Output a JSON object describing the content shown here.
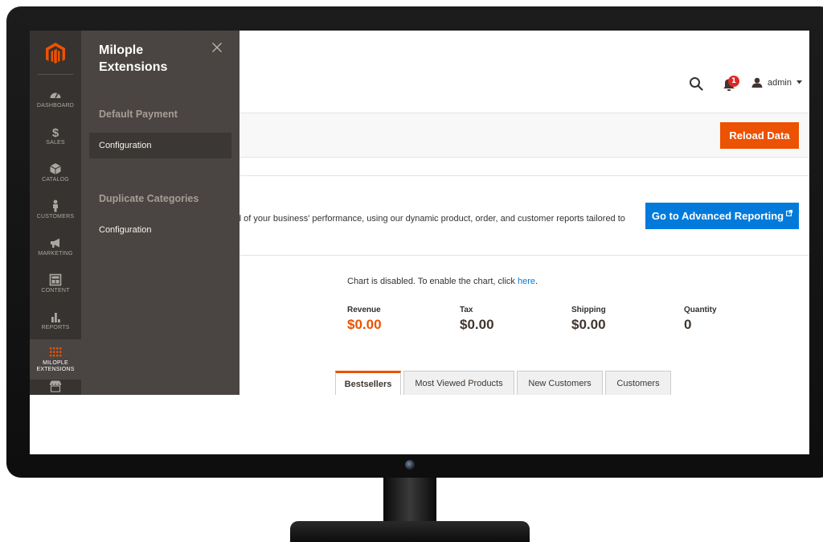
{
  "nav": {
    "items": [
      {
        "label": "DASHBOARD",
        "icon": "dashboard-icon"
      },
      {
        "label": "SALES",
        "icon": "dollar-icon"
      },
      {
        "label": "CATALOG",
        "icon": "box-icon"
      },
      {
        "label": "CUSTOMERS",
        "icon": "person-icon"
      },
      {
        "label": "MARKETING",
        "icon": "megaphone-icon"
      },
      {
        "label": "CONTENT",
        "icon": "layout-icon"
      },
      {
        "label": "REPORTS",
        "icon": "bar-chart-icon"
      },
      {
        "label_line1": "MILOPLE",
        "label_line2": "EXTENSIONS",
        "icon": "grid-dots-icon"
      },
      {
        "label": "",
        "icon": "store-icon"
      }
    ]
  },
  "flyout": {
    "title": "Milople Extensions",
    "sections": [
      {
        "heading": "Default Payment",
        "link": "Configuration"
      },
      {
        "heading": "Duplicate Categories",
        "link": "Configuration"
      }
    ]
  },
  "header": {
    "notification_count": "1",
    "user_name": "admin"
  },
  "actions": {
    "reload_label": "Reload Data"
  },
  "intro": {
    "text": "d of your business' performance, using our dynamic product, order, and customer reports tailored to",
    "advanced_label": "Go to Advanced Reporting"
  },
  "chart_notice": {
    "prefix": "Chart is disabled. To enable the chart, click",
    "link": "here",
    "suffix": "."
  },
  "totals": [
    {
      "label": "Revenue",
      "value": "$0.00"
    },
    {
      "label": "Tax",
      "value": "$0.00"
    },
    {
      "label": "Shipping",
      "value": "$0.00"
    },
    {
      "label": "Quantity",
      "value": "0"
    }
  ],
  "tabs": [
    "Bestsellers",
    "Most Viewed Products",
    "New Customers",
    "Customers"
  ],
  "colors": {
    "accent": "#eb5202",
    "link": "#007bdb",
    "nav_bg": "#373330",
    "flyout_bg": "#4a4542"
  }
}
